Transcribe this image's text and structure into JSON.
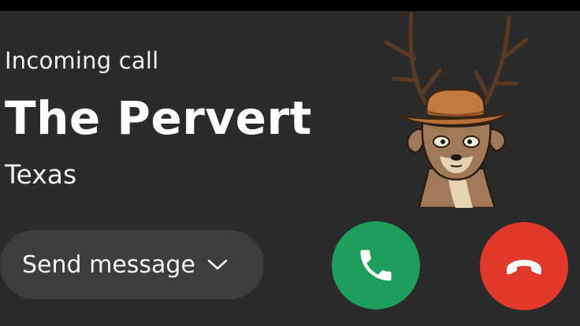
{
  "call": {
    "status_label": "Incoming call",
    "caller_name": "The Pervert",
    "caller_location": "Texas"
  },
  "actions": {
    "send_message_label": "Send message",
    "answer_icon": "phone-icon",
    "decline_icon": "phone-hangup-icon"
  },
  "colors": {
    "background": "#2b2b2b",
    "answer": "#1d9e5b",
    "decline": "#e3382c",
    "pill": "#3d3d3d"
  },
  "avatar": {
    "depicts": "deer-with-cowboy-hat"
  }
}
